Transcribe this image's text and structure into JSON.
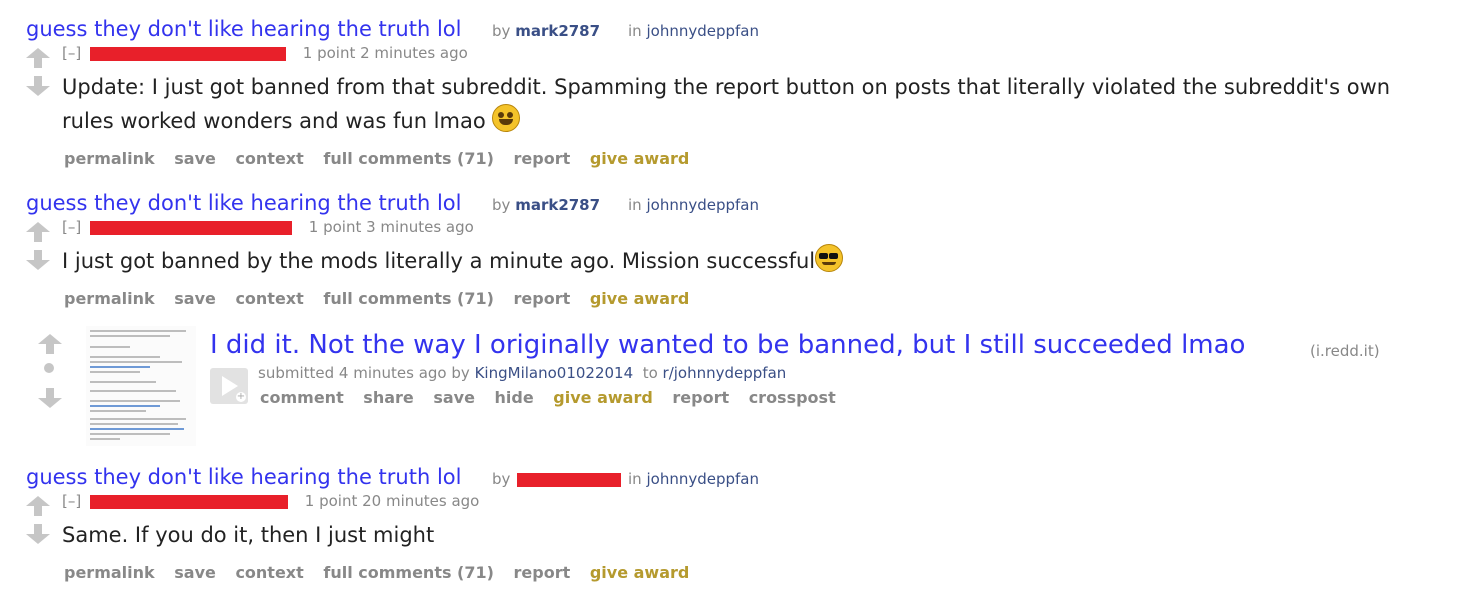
{
  "comments": [
    {
      "post_title": "guess they don't like hearing the truth lol",
      "by_label": "by",
      "author": "mark2787",
      "in_label": "in",
      "subreddit": "johnnydeppfan",
      "expand": "[–]",
      "score_time": "1 point 2 minutes ago",
      "body": "Update: I just got banned from that subreddit. Spamming the report button on posts that literally violated the subreddit's own rules worked wonders and was fun lmao",
      "emoji": "rofl-emoji",
      "buttons": [
        "permalink",
        "save",
        "context",
        "full comments (71)",
        "report",
        "give award"
      ]
    },
    {
      "post_title": "guess they don't like hearing the truth lol",
      "by_label": "by",
      "author": "mark2787",
      "in_label": "in",
      "subreddit": "johnnydeppfan",
      "expand": "[–]",
      "score_time": "1 point 3 minutes ago",
      "body": "I just got banned by the mods literally a minute ago. Mission successful",
      "emoji": "sunglasses-emoji",
      "buttons": [
        "permalink",
        "save",
        "context",
        "full comments (71)",
        "report",
        "give award"
      ]
    },
    {
      "post_title": "guess they don't like hearing the truth lol",
      "by_label": "by",
      "author": "",
      "in_label": "in",
      "subreddit": "johnnydeppfan",
      "expand": "[–]",
      "score_time": "1 point 20 minutes ago",
      "body": "Same. If you do it, then I just might",
      "buttons": [
        "permalink",
        "save",
        "context",
        "full comments (71)",
        "report",
        "give award"
      ]
    }
  ],
  "post": {
    "title": "I did it. Not the way I originally wanted to be banned, but I still succeeded lmao",
    "domain": "(i.redd.it)",
    "submitted_prefix": "submitted",
    "time": "4 minutes ago",
    "by_label": "by",
    "author": "KingMilano01022014",
    "to_label": "to",
    "subreddit": "r/johnnydeppfan",
    "buttons": [
      "comment",
      "share",
      "save",
      "hide",
      "give award",
      "report",
      "crosspost"
    ]
  },
  "colors": {
    "link": "#3333ee",
    "muted": "#888888",
    "author": "#3a4f86",
    "award": "#b59a2e",
    "redaction": "#e8202a"
  }
}
